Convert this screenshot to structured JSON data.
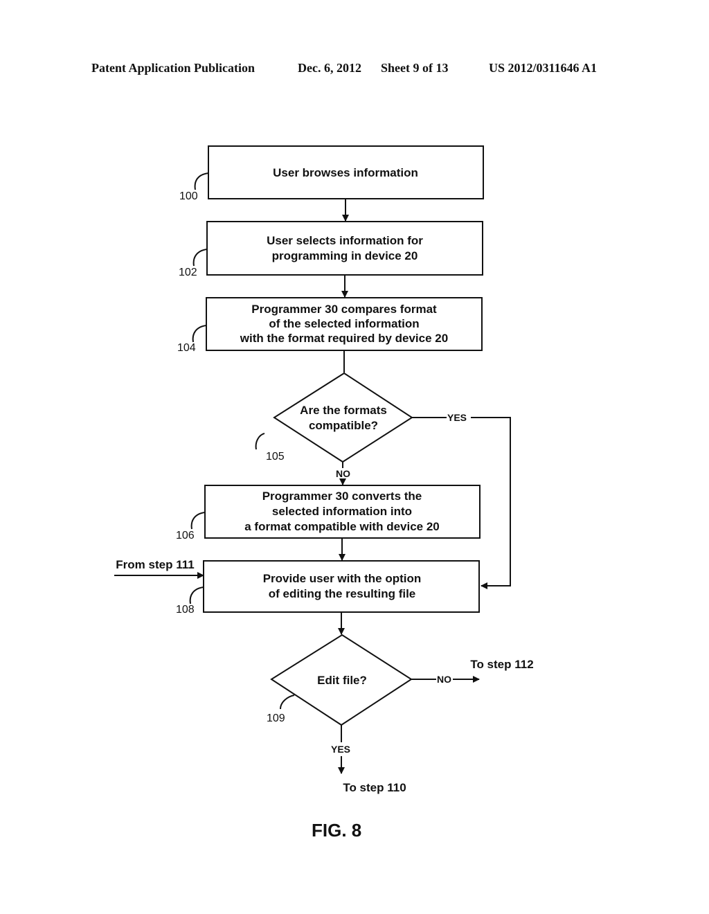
{
  "header": {
    "publication": "Patent Application Publication",
    "date": "Dec. 6, 2012",
    "sheet": "Sheet 9 of 13",
    "number": "US 2012/0311646 A1"
  },
  "flowchart": {
    "steps": [
      {
        "ref": "100",
        "type": "process",
        "lines": [
          "User browses information"
        ]
      },
      {
        "ref": "102",
        "type": "process",
        "lines": [
          "User selects information for",
          "programming in device 20"
        ]
      },
      {
        "ref": "104",
        "type": "process",
        "lines": [
          "Programmer 30 compares format",
          "of the selected information",
          "with the format required by device 20"
        ]
      },
      {
        "ref": "105",
        "type": "decision",
        "lines": [
          "Are the formats",
          "compatible?"
        ]
      },
      {
        "ref": "106",
        "type": "process",
        "lines": [
          "Programmer 30 converts the",
          "selected information into",
          "a format compatible with device 20"
        ]
      },
      {
        "ref": "108",
        "type": "process",
        "lines": [
          "Provide user with the option",
          "of editing the resulting file"
        ]
      },
      {
        "ref": "109",
        "type": "decision",
        "lines": [
          "Edit file?"
        ]
      }
    ],
    "branch_labels": {
      "d105_yes": "YES",
      "d105_no": "NO",
      "d109_no": "NO",
      "d109_yes": "YES"
    },
    "connectors": {
      "from_step": "From step 111",
      "to_step_112": "To step 112",
      "to_step_110": "To step 110"
    },
    "figure_label": "FIG. 8"
  }
}
